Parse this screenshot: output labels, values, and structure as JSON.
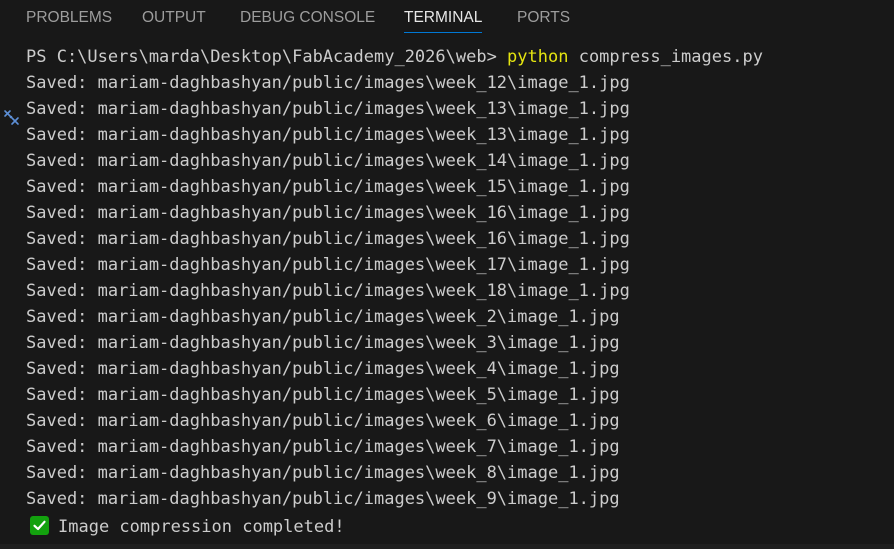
{
  "tabs": [
    {
      "label": "PROBLEMS",
      "active": false
    },
    {
      "label": "OUTPUT",
      "active": false
    },
    {
      "label": "DEBUG CONSOLE",
      "active": false
    },
    {
      "label": "TERMINAL",
      "active": true
    },
    {
      "label": "PORTS",
      "active": false
    }
  ],
  "terminal": {
    "prompt": "PS C:\\Users\\marda\\Desktop\\FabAcademy_2026\\web> ",
    "command_exe": "python",
    "command_args": " compress_images.py",
    "lines": [
      "Saved: mariam-daghbashyan/public/images\\week_12\\image_1.jpg",
      "Saved: mariam-daghbashyan/public/images\\week_13\\image_1.jpg",
      "Saved: mariam-daghbashyan/public/images\\week_13\\image_1.jpg",
      "Saved: mariam-daghbashyan/public/images\\week_14\\image_1.jpg",
      "Saved: mariam-daghbashyan/public/images\\week_15\\image_1.jpg",
      "Saved: mariam-daghbashyan/public/images\\week_16\\image_1.jpg",
      "Saved: mariam-daghbashyan/public/images\\week_16\\image_1.jpg",
      "Saved: mariam-daghbashyan/public/images\\week_17\\image_1.jpg",
      "Saved: mariam-daghbashyan/public/images\\week_18\\image_1.jpg",
      "Saved: mariam-daghbashyan/public/images\\week_2\\image_1.jpg",
      "Saved: mariam-daghbashyan/public/images\\week_3\\image_1.jpg",
      "Saved: mariam-daghbashyan/public/images\\week_4\\image_1.jpg",
      "Saved: mariam-daghbashyan/public/images\\week_5\\image_1.jpg",
      "Saved: mariam-daghbashyan/public/images\\week_6\\image_1.jpg",
      "Saved: mariam-daghbashyan/public/images\\week_7\\image_1.jpg",
      "Saved: mariam-daghbashyan/public/images\\week_8\\image_1.jpg",
      "Saved: mariam-daghbashyan/public/images\\week_9\\image_1.jpg"
    ],
    "completion_message": "Image compression completed!",
    "completion_icon": "check-mark-icon"
  },
  "colors": {
    "background": "#181818",
    "text": "#cccccc",
    "tab_inactive": "#9d9d9d",
    "tab_active": "#e7e7e7",
    "tab_underline": "#0078d4",
    "command_highlight": "#e5e510",
    "check_green": "#13a10e"
  }
}
